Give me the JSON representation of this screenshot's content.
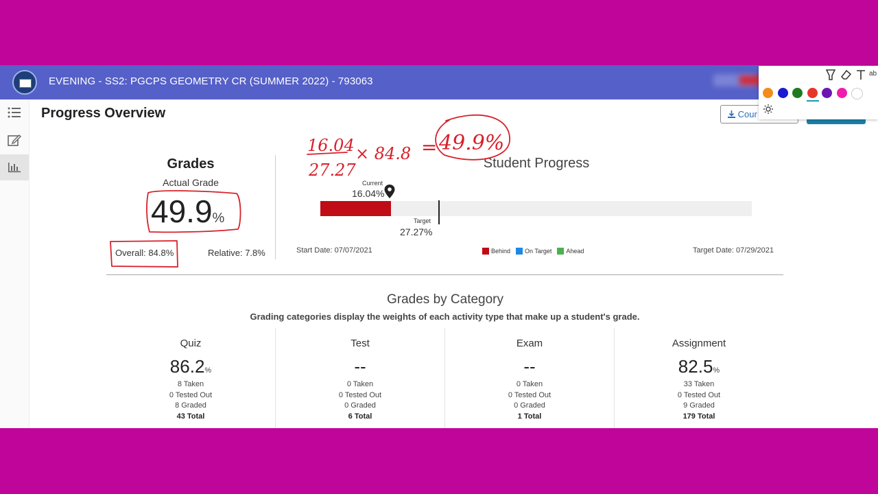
{
  "header": {
    "course_title": "EVENING - SS2: PGCPS GEOMETRY CR (SUMMER 2022) - 793063"
  },
  "page": {
    "title": "Progress Overview",
    "course_button_label": "Cour"
  },
  "grades": {
    "heading": "Grades",
    "actual_label": "Actual Grade",
    "actual_value": "49.9",
    "percent_sign": "%",
    "overall": "Overall: 84.8%",
    "relative": "Relative: 7.8%"
  },
  "progress": {
    "title": "Student Progress",
    "current_label": "Current",
    "current_value": "16.04%",
    "current_percent": 16.04,
    "target_label": "Target",
    "target_value": "27.27%",
    "target_percent": 27.27,
    "start_date": "Start Date: 07/07/2021",
    "target_date": "Target Date: 07/29/2021",
    "legend": [
      {
        "label": "Behind",
        "color": "#c00c16"
      },
      {
        "label": "On Target",
        "color": "#1e88e5"
      },
      {
        "label": "Ahead",
        "color": "#4caf50"
      }
    ]
  },
  "categories": {
    "title": "Grades by Category",
    "subtitle": "Grading categories display the weights of each activity type that make up a student's grade.",
    "items": [
      {
        "name": "Quiz",
        "value": "86.2",
        "pct": "%",
        "taken": "8 Taken",
        "tested_out": "0 Tested Out",
        "graded": "8 Graded",
        "total": "43 Total"
      },
      {
        "name": "Test",
        "value": "--",
        "pct": "",
        "taken": "0 Taken",
        "tested_out": "0 Tested Out",
        "graded": "0 Graded",
        "total": "6 Total"
      },
      {
        "name": "Exam",
        "value": "--",
        "pct": "",
        "taken": "0 Taken",
        "tested_out": "0 Tested Out",
        "graded": "0 Graded",
        "total": "1 Total"
      },
      {
        "name": "Assignment",
        "value": "82.5",
        "pct": "%",
        "taken": "33 Taken",
        "tested_out": "0 Tested Out",
        "graded": "9 Graded",
        "total": "179 Total"
      }
    ]
  },
  "annotation": {
    "numerator": "16.04",
    "denominator": "27.27",
    "times": "× 84.8",
    "equals": "=",
    "result": "49.9%",
    "ink_color": "#d8202a"
  },
  "ink_toolbar": {
    "text_tool": "ab",
    "colors": [
      "#f28c1c",
      "#1a1ad0",
      "#1e7a1e",
      "#e8352a",
      "#6a18b0",
      "#f01cae",
      "#ffffff"
    ]
  },
  "colors": {
    "page_background": "#c0069a",
    "header_bar": "#5560c8",
    "behind_bar": "#c00c16"
  }
}
